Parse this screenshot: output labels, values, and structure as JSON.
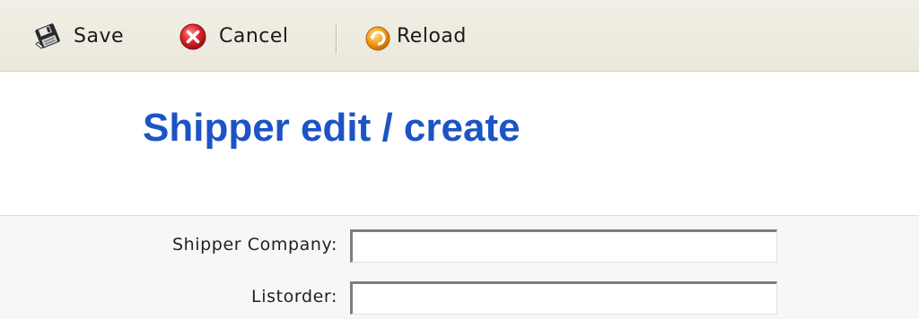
{
  "toolbar": {
    "save_label": "Save",
    "cancel_label": "Cancel",
    "reload_label": "Reload",
    "icons": {
      "save": "floppy-disk-icon",
      "cancel": "red-cancel-icon",
      "reload": "orange-reload-icon"
    }
  },
  "page": {
    "title": "Shipper edit / create"
  },
  "form": {
    "shipper_company": {
      "label": "Shipper Company:",
      "value": ""
    },
    "listorder": {
      "label": "Listorder:",
      "value": ""
    }
  },
  "colors": {
    "title": "#1c54c6",
    "toolbar_bg": "#ece9dd",
    "form_bg": "#f7f7f6"
  }
}
